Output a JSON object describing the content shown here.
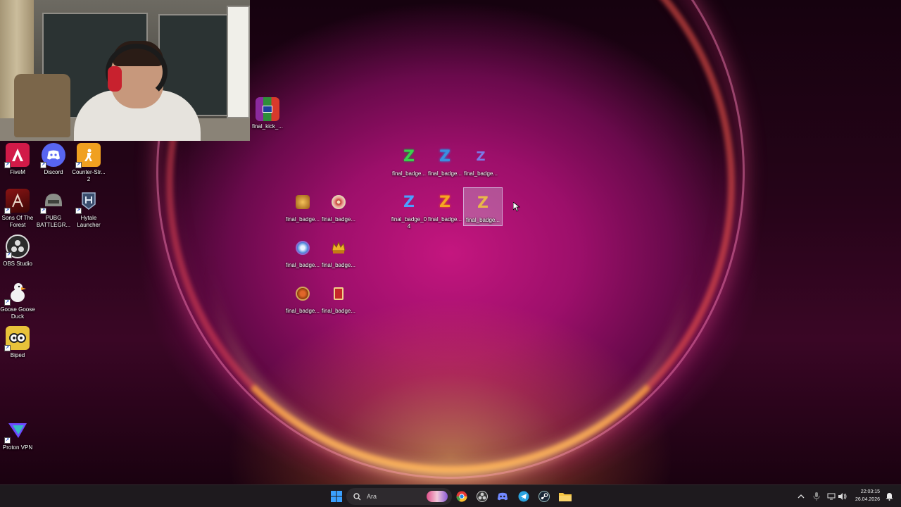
{
  "desktop": {
    "icons_left": [
      {
        "label": "FiveM"
      },
      {
        "label": "Discord"
      },
      {
        "label": "Counter-Str...\n2"
      },
      {
        "label": "Sons Of The\nForest"
      },
      {
        "label": "PUBG\nBATTLEGR..."
      },
      {
        "label": "Hytale\nLauncher"
      },
      {
        "label": "OBS Studio"
      },
      {
        "label": "Goose Goose\nDuck"
      },
      {
        "label": "Biped"
      },
      {
        "label": "Proton VPN"
      }
    ],
    "archive_icon": {
      "label": "final_kick_..."
    },
    "badge_icons": [
      {
        "label": "final_badge..."
      },
      {
        "label": "final_badge..."
      },
      {
        "label": "final_badge..."
      },
      {
        "label": "final_badge..."
      },
      {
        "label": "final_badge..."
      },
      {
        "label": "final_badge_0\n4"
      },
      {
        "label": "final_badge..."
      },
      {
        "label": "final_badge..."
      },
      {
        "label": "final_badge..."
      },
      {
        "label": "final_badge..."
      },
      {
        "label": "final_badge..."
      },
      {
        "label": "final_badge..."
      }
    ],
    "badge_letter": "Z",
    "colors": {
      "z_green": "#3ccf4e",
      "z_blue": "#3b8fe0",
      "z_purple": "#6b6bd8",
      "z_orange": "#f5a623"
    }
  },
  "taskbar": {
    "search_placeholder": "Ara",
    "time": "22:03:15",
    "date": "26.04.2026",
    "apps": [
      "start-icon",
      "search-icon",
      "chrome-icon",
      "obs-icon",
      "discord-icon",
      "telegram-icon",
      "steam-icon",
      "file-explorer-icon"
    ]
  }
}
